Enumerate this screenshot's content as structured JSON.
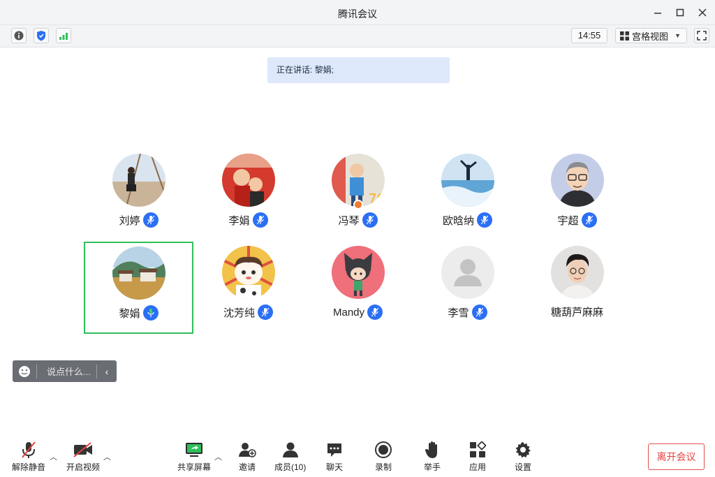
{
  "window": {
    "title": "腾讯会议"
  },
  "toolbar": {
    "time": "14:55",
    "view_label": "宫格视图"
  },
  "speaking": {
    "text": "正在讲话: 黎娟;"
  },
  "participants": [
    {
      "name": "刘婷",
      "avatar": "photo-woman-on-dock"
    },
    {
      "name": "李娟",
      "avatar": "photo-children-red"
    },
    {
      "name": "冯琴",
      "avatar": "photo-child-blue"
    },
    {
      "name": "欧晗纳",
      "avatar": "photo-beach-jump"
    },
    {
      "name": "宇超",
      "avatar": "cartoon-man-glasses"
    },
    {
      "name": "黎娟",
      "avatar": "photo-village",
      "active": true
    },
    {
      "name": "沈芳纯",
      "avatar": "cartoon-girl-cow"
    },
    {
      "name": "Mandy",
      "avatar": "cartoon-girl-cat"
    },
    {
      "name": "李雪",
      "avatar": "default-user-icon"
    },
    {
      "name": "糖葫芦麻麻",
      "avatar": "photo-young-man"
    }
  ],
  "chat": {
    "placeholder": "说点什么..."
  },
  "bottom": {
    "unmute": "解除静音",
    "start_video": "开启视频",
    "share_screen": "共享屏幕",
    "invite": "邀请",
    "members": "成员(10)",
    "chat": "聊天",
    "record": "录制",
    "raise_hand": "举手",
    "apps": "应用",
    "settings": "设置",
    "leave": "离开会议"
  },
  "colors": {
    "accent": "#2b6ff5",
    "active_border": "#2fbf5b",
    "leave": "#e34242",
    "speaking_bg": "#dde9fb"
  }
}
